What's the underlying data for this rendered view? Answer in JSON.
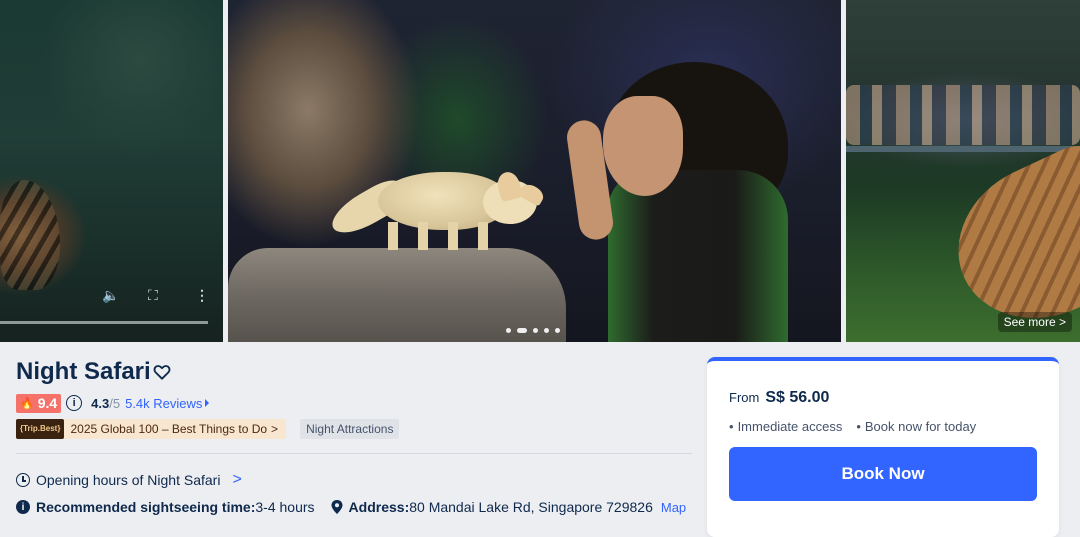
{
  "gallery": {
    "see_more_label": "See more",
    "see_more_chevron": ">",
    "video_controls": {
      "volume_icon": "🔈",
      "fullscreen_icon": "⛶",
      "more_icon": "⋮"
    },
    "dots_count": 5,
    "active_dot": 1
  },
  "attraction": {
    "title": "Night Safari",
    "heart_icon": "heart-outline-icon",
    "score": "9.4",
    "score_icon": "flame-icon",
    "info_icon": "i",
    "rating": "4.3",
    "rating_max": "/5",
    "reviews": "5.4k Reviews",
    "tripbest_logo": "{Trip.Best}",
    "award": "2025 Global 100 – Best Things to Do",
    "award_chevron": ">",
    "category_tag": "Night Attractions",
    "opening_hours": "Opening hours of Night Safari",
    "opening_chevron": ">",
    "sightseeing_label": "Recommended sightseeing time:",
    "sightseeing_value": "3-4 hours",
    "address_label": "Address:",
    "address_value": "80 Mandai Lake Rd, Singapore 729826",
    "map_link": "Map"
  },
  "booking": {
    "from_label": "From",
    "price": "S$ 56.00",
    "features": [
      "Immediate access",
      "Book now for today"
    ],
    "book_button": "Book Now"
  },
  "colors": {
    "accent": "#3264ff",
    "score_badge": "#f4726a",
    "text_primary": "#0f294d",
    "page_bg": "#eceef1"
  }
}
